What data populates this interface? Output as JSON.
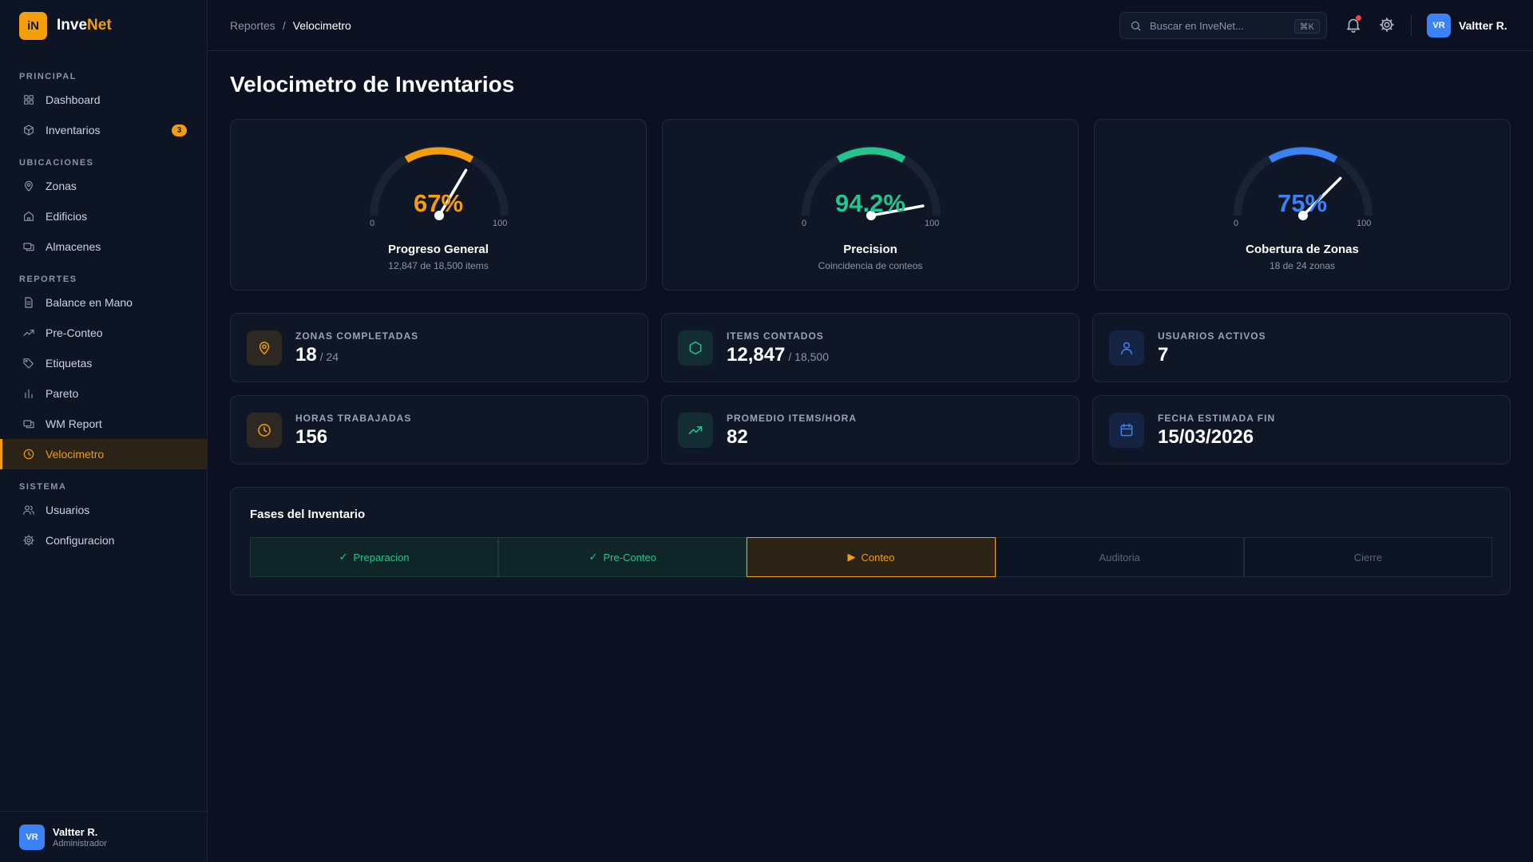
{
  "brand": {
    "logo": "iN",
    "name_part1": "Inve",
    "name_part2": "Net"
  },
  "sidebar": {
    "sections": [
      {
        "title": "PRINCIPAL",
        "items": [
          {
            "label": "Dashboard",
            "icon": "grid-icon"
          },
          {
            "label": "Inventarios",
            "icon": "box-icon",
            "badge": "3"
          }
        ]
      },
      {
        "title": "UBICACIONES",
        "items": [
          {
            "label": "Zonas",
            "icon": "map-pin-icon"
          },
          {
            "label": "Edificios",
            "icon": "building-icon"
          },
          {
            "label": "Almacenes",
            "icon": "warehouse-icon"
          }
        ]
      },
      {
        "title": "REPORTES",
        "items": [
          {
            "label": "Balance en Mano",
            "icon": "document-icon"
          },
          {
            "label": "Pre-Conteo",
            "icon": "trending-up-icon"
          },
          {
            "label": "Etiquetas",
            "icon": "tag-icon"
          },
          {
            "label": "Pareto",
            "icon": "bar-chart-icon"
          },
          {
            "label": "WM Report",
            "icon": "report-icon"
          },
          {
            "label": "Velocimetro",
            "icon": "clock-icon",
            "active": true
          }
        ]
      },
      {
        "title": "SISTEMA",
        "items": [
          {
            "label": "Usuarios",
            "icon": "users-icon"
          },
          {
            "label": "Configuracion",
            "icon": "gear-icon"
          }
        ]
      }
    ],
    "user": {
      "initials": "VR",
      "name": "Valtter R.",
      "role": "Administrador"
    }
  },
  "header": {
    "breadcrumb_parent": "Reportes",
    "breadcrumb_separator": "/",
    "breadcrumb_current": "Velocimetro",
    "search_placeholder": "Buscar en InveNet...",
    "search_shortcut": "⌘K",
    "user_initials": "VR",
    "user_name": "Valtter R."
  },
  "page": {
    "title": "Velocimetro de Inventarios"
  },
  "gauges": [
    {
      "value": 67,
      "display": "67%",
      "label": "Progreso General",
      "sub": "12,847 de 18,500 items",
      "color": "#f59e0b",
      "min": "0",
      "max": "100"
    },
    {
      "value": 94.2,
      "display": "94.2%",
      "label": "Precision",
      "sub": "Coincidencia de conteos",
      "color": "#22c58e",
      "min": "0",
      "max": "100"
    },
    {
      "value": 75,
      "display": "75%",
      "label": "Cobertura de Zonas",
      "sub": "18 de 24 zonas",
      "color": "#3b82f6",
      "min": "0",
      "max": "100"
    }
  ],
  "stats": [
    {
      "label": "ZONAS COMPLETADAS",
      "value": "18",
      "suffix": "/ 24",
      "icon": "map-pin-icon",
      "color": "#f59e0b"
    },
    {
      "label": "ITEMS CONTADOS",
      "value": "12,847",
      "suffix": "/ 18,500",
      "icon": "hexagon-icon",
      "color": "#22c58e"
    },
    {
      "label": "USUARIOS ACTIVOS",
      "value": "7",
      "suffix": "",
      "icon": "user-icon",
      "color": "#3b82f6"
    },
    {
      "label": "HORAS TRABAJADAS",
      "value": "156",
      "suffix": "",
      "icon": "clock-icon",
      "color": "#f59e0b"
    },
    {
      "label": "PROMEDIO ITEMS/HORA",
      "value": "82",
      "suffix": "",
      "icon": "trending-up-icon",
      "color": "#22c58e"
    },
    {
      "label": "FECHA ESTIMADA FIN",
      "value": "15/03/2026",
      "suffix": "",
      "icon": "calendar-icon",
      "color": "#3b82f6"
    }
  ],
  "phases": {
    "title": "Fases del Inventario",
    "items": [
      {
        "label": "Preparacion",
        "status": "done",
        "mark": "✓"
      },
      {
        "label": "Pre-Conteo",
        "status": "done",
        "mark": "✓"
      },
      {
        "label": "Conteo",
        "status": "current",
        "mark": "▶"
      },
      {
        "label": "Auditoria",
        "status": "pending",
        "mark": ""
      },
      {
        "label": "Cierre",
        "status": "pending",
        "mark": ""
      }
    ]
  }
}
